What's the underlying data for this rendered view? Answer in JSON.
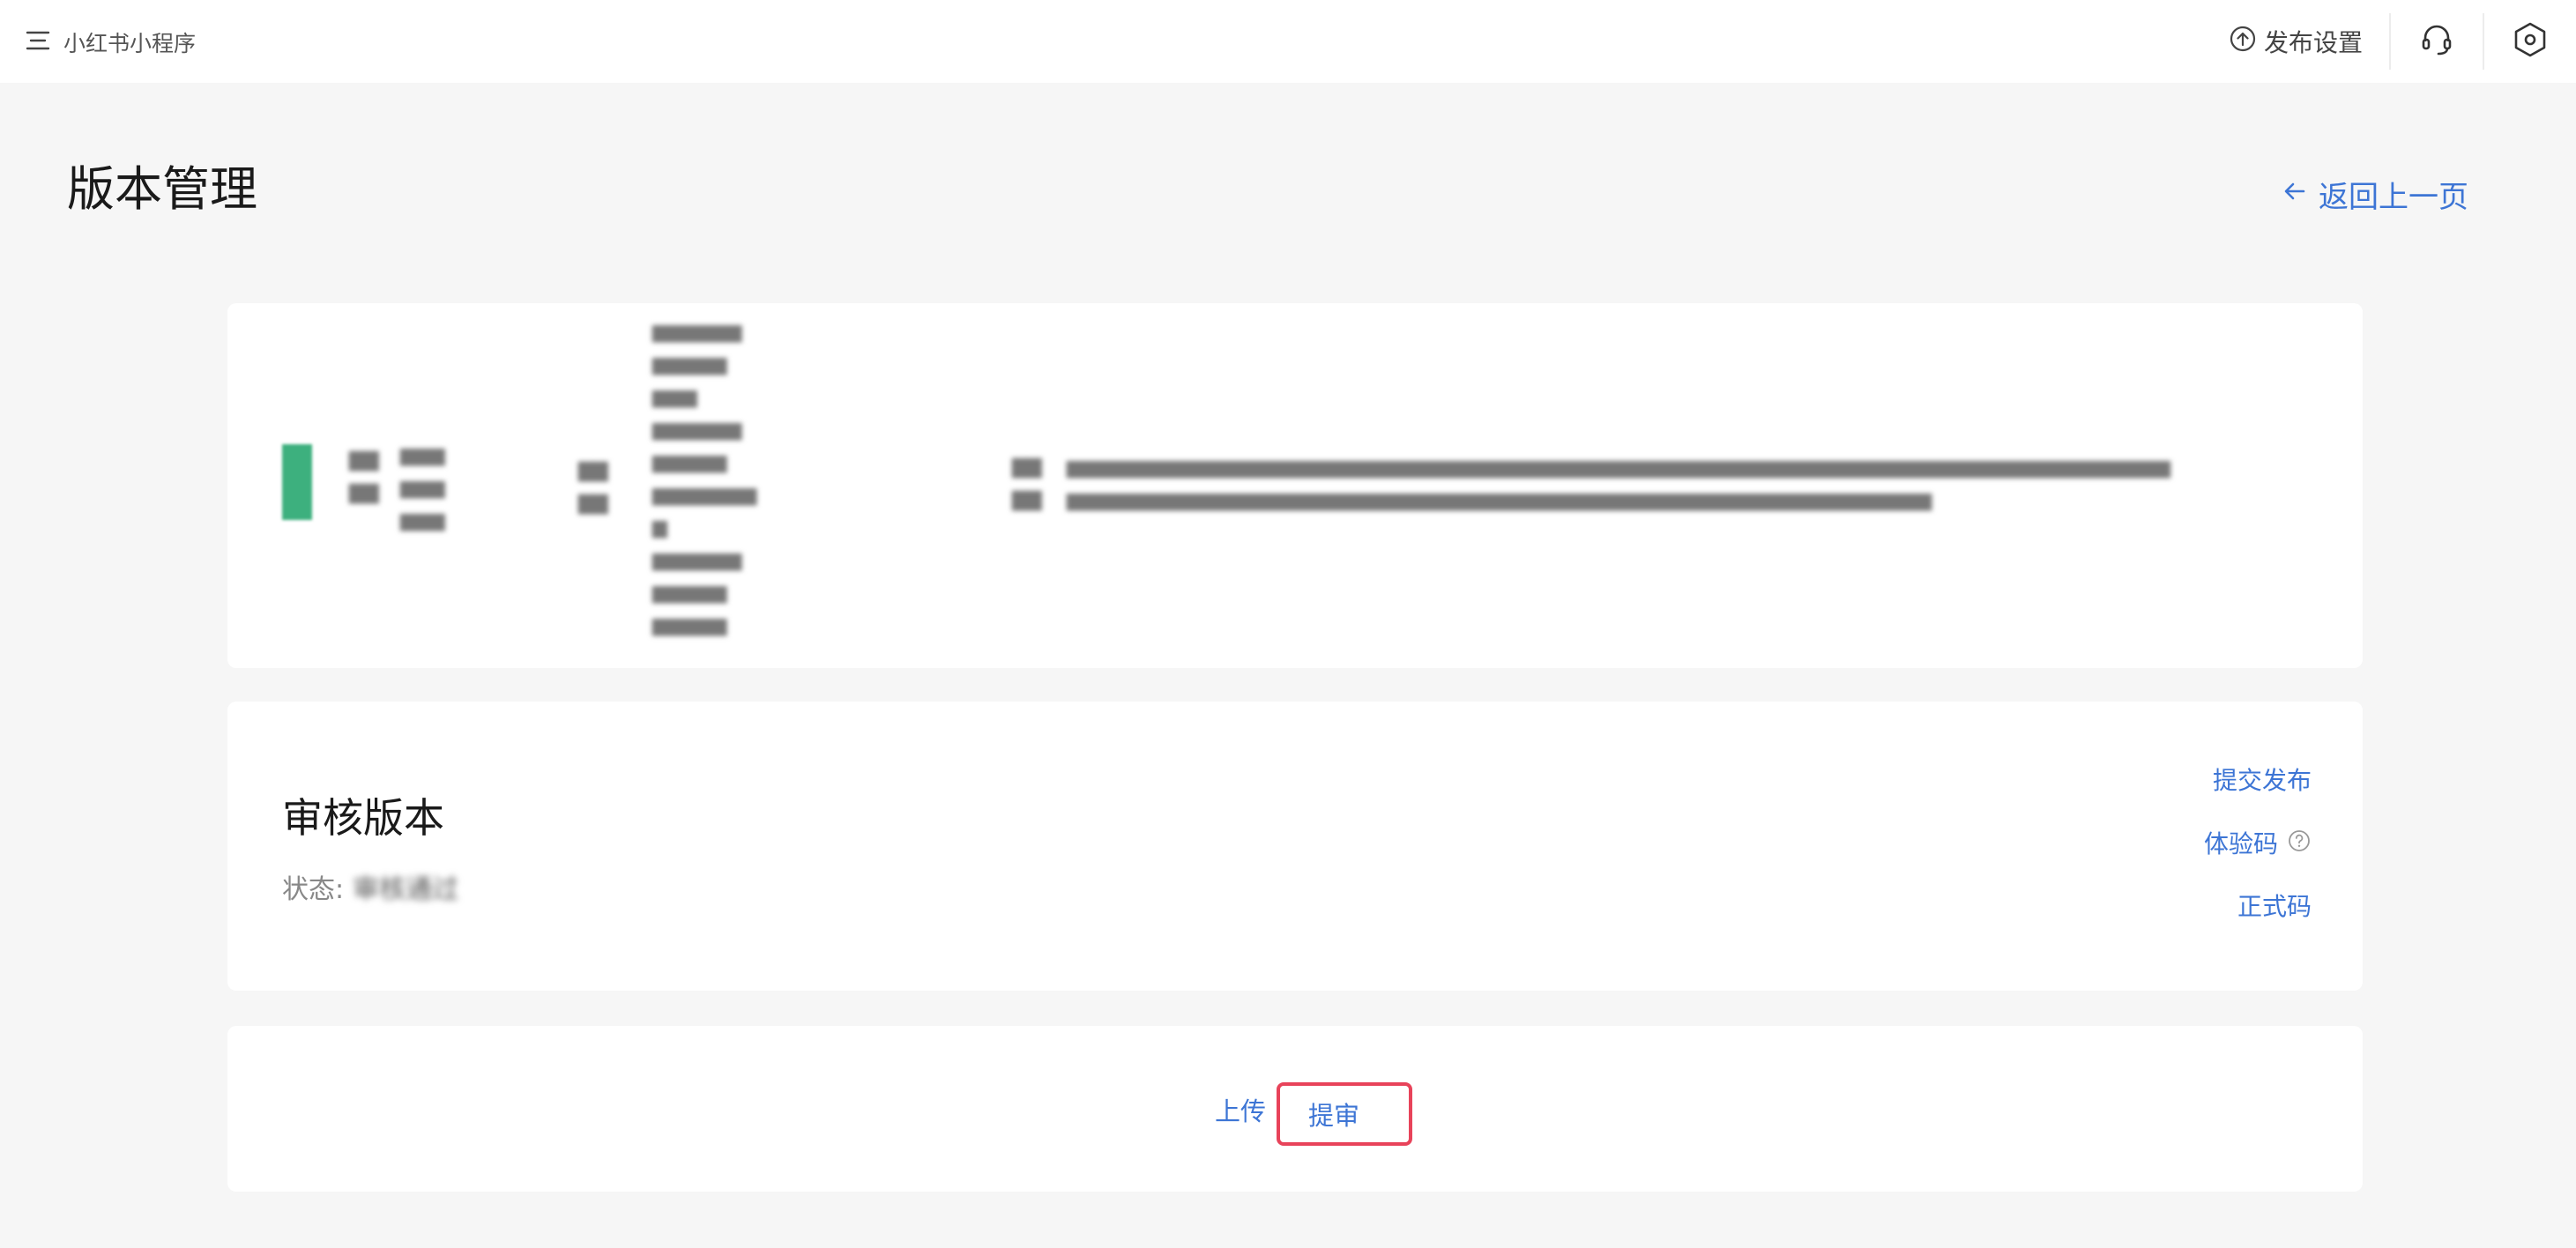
{
  "header": {
    "app_name": "小红书小程序",
    "publish_settings_label": "发布设置"
  },
  "page": {
    "title": "版本管理",
    "back_label": "返回上一页"
  },
  "review": {
    "title": "审核版本",
    "status_label": "状态:",
    "status_value": "审核通过",
    "actions": {
      "submit_publish": "提交发布",
      "trial_code": "体验码",
      "official_code": "正式码"
    }
  },
  "bottom": {
    "upload_label": "上传",
    "submit_review_label": "提审"
  },
  "colors": {
    "accent": "#3d75d5",
    "highlight": "#e8435a"
  }
}
